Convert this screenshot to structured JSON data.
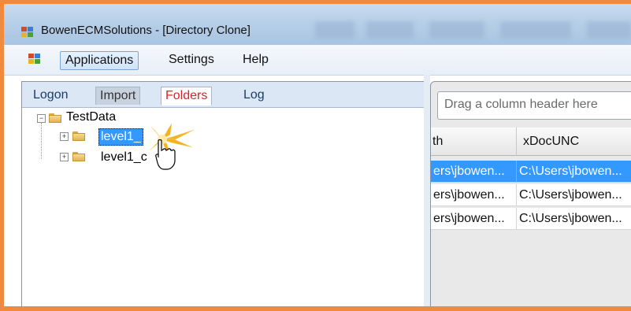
{
  "window": {
    "title": "BowenECMSolutions - [Directory Clone]"
  },
  "menu": [
    {
      "label": "Applications",
      "active": true
    },
    {
      "label": "Settings",
      "active": false
    },
    {
      "label": "Help",
      "active": false
    }
  ],
  "tabs": [
    {
      "label": "Logon"
    },
    {
      "label": "Import"
    },
    {
      "label": "Folders"
    },
    {
      "label": "Log"
    }
  ],
  "tree": {
    "root": "TestData",
    "children": [
      {
        "label": "level1_",
        "selected": true
      },
      {
        "label": "level1_c",
        "selected": false
      }
    ]
  },
  "grid": {
    "group_hint": "Drag a column header here",
    "columns": [
      "th",
      "xDocUNC"
    ],
    "rows": [
      {
        "cells": [
          "ers\\jbowen...",
          "C:\\Users\\jbowen..."
        ],
        "selected": true
      },
      {
        "cells": [
          "ers\\jbowen...",
          "C:\\Users\\jbowen..."
        ],
        "selected": false
      },
      {
        "cells": [
          "ers\\jbowen...",
          "C:\\Users\\jbowen..."
        ],
        "selected": false
      }
    ]
  },
  "colors": {
    "frame": "#ef8a3e",
    "selection": "#3399ff",
    "folders_tab_text": "#d8232a"
  }
}
